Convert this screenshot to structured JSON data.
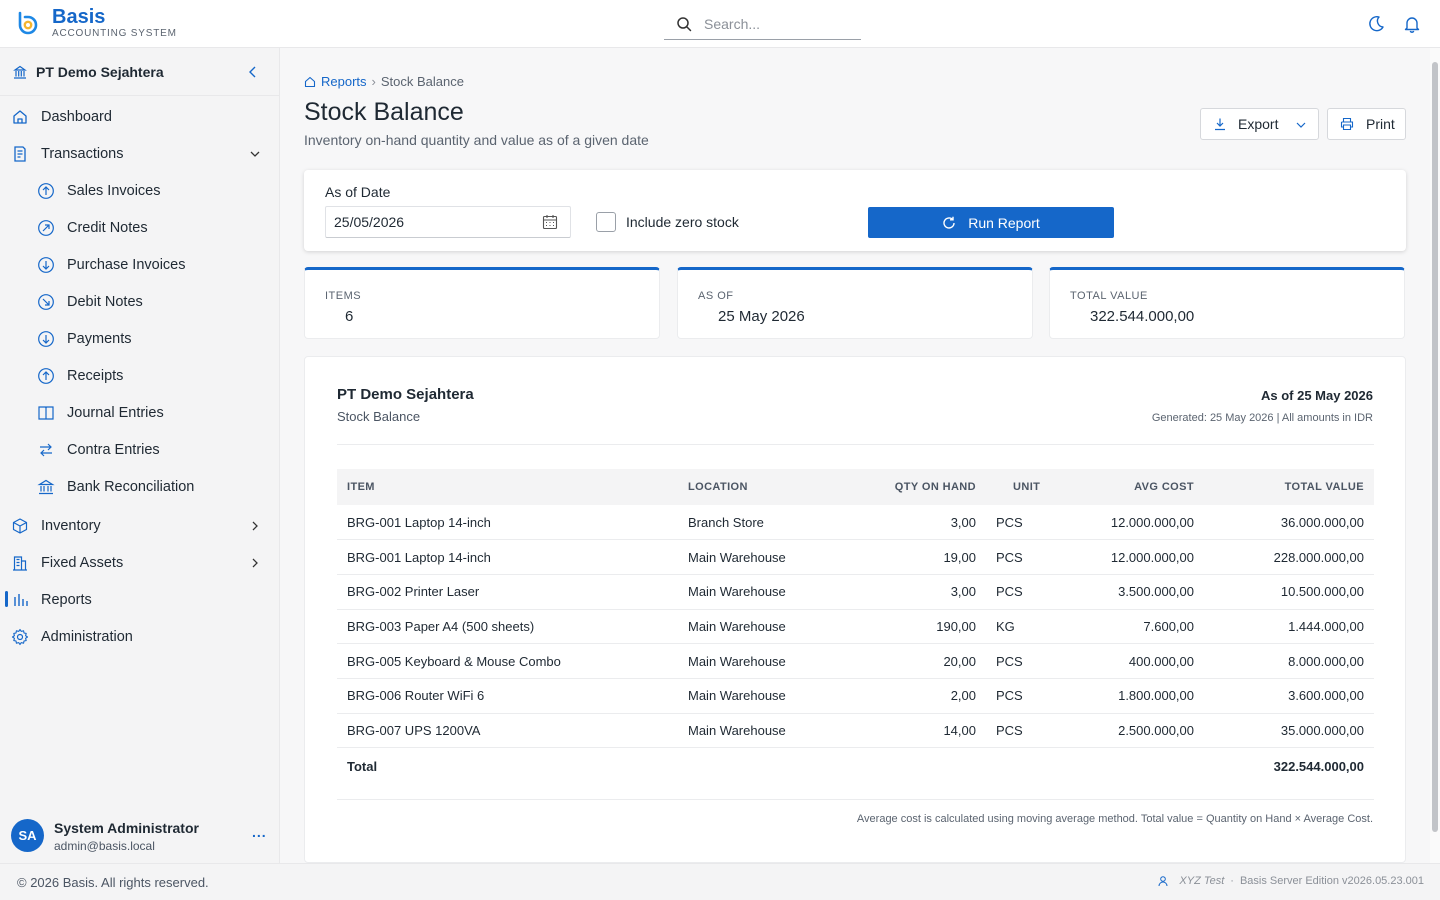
{
  "brand": {
    "name": "Basis",
    "subtitle": "ACCOUNTING SYSTEM"
  },
  "search": {
    "placeholder": "Search..."
  },
  "sidebar": {
    "company": "PT Demo Sejahtera",
    "items": [
      {
        "label": "Dashboard",
        "icon": "home-icon"
      },
      {
        "label": "Transactions",
        "icon": "receipt-icon",
        "expanded": true
      },
      {
        "label": "Sales Invoices",
        "icon": "arrow-up-circle-icon"
      },
      {
        "label": "Credit Notes",
        "icon": "arrow-up-right-circle-icon"
      },
      {
        "label": "Purchase Invoices",
        "icon": "arrow-down-circle-icon"
      },
      {
        "label": "Debit Notes",
        "icon": "arrow-down-right-circle-icon"
      },
      {
        "label": "Payments",
        "icon": "arrow-down-circle-icon"
      },
      {
        "label": "Receipts",
        "icon": "arrow-up-circle-icon"
      },
      {
        "label": "Journal Entries",
        "icon": "book-icon"
      },
      {
        "label": "Contra Entries",
        "icon": "swap-icon"
      },
      {
        "label": "Bank Reconciliation",
        "icon": "bank-icon"
      },
      {
        "label": "Inventory",
        "icon": "box-icon"
      },
      {
        "label": "Fixed Assets",
        "icon": "building-icon"
      },
      {
        "label": "Reports",
        "icon": "bar-chart-icon",
        "active": true
      },
      {
        "label": "Administration",
        "icon": "gear-icon"
      }
    ],
    "user": {
      "initials": "SA",
      "name": "System Administrator",
      "email": "admin@basis.local",
      "more": "..."
    }
  },
  "breadcrumb": {
    "parent": "Reports",
    "separator": "›",
    "current": "Stock Balance"
  },
  "page": {
    "title": "Stock Balance",
    "subtitle": "Inventory on-hand quantity and value as of a given date",
    "export_label": "Export",
    "print_label": "Print"
  },
  "filter": {
    "date_label": "As of Date",
    "date_value": "25/05/2026",
    "zero_stock_label": "Include zero stock",
    "zero_stock_checked": false,
    "run_label": "Run Report"
  },
  "stats": [
    {
      "label": "ITEMS",
      "value": "6"
    },
    {
      "label": "AS OF",
      "value": "25 May 2026"
    },
    {
      "label": "TOTAL VALUE",
      "value": "322.544.000,00"
    }
  ],
  "report": {
    "company": "PT Demo Sejahtera",
    "title": "Stock Balance",
    "as_of": "As of 25 May 2026",
    "generated": "Generated: 25 May 2026 | All amounts in IDR",
    "columns": [
      "ITEM",
      "LOCATION",
      "QTY ON HAND",
      "UNIT",
      "AVG COST",
      "TOTAL VALUE"
    ],
    "rows": [
      {
        "item": "BRG-001  Laptop 14-inch",
        "location": "Branch Store",
        "qty": "3,00",
        "unit": "PCS",
        "avg_cost": "12.000.000,00",
        "total": "36.000.000,00"
      },
      {
        "item": "BRG-001  Laptop 14-inch",
        "location": "Main Warehouse",
        "qty": "19,00",
        "unit": "PCS",
        "avg_cost": "12.000.000,00",
        "total": "228.000.000,00"
      },
      {
        "item": "BRG-002  Printer Laser",
        "location": "Main Warehouse",
        "qty": "3,00",
        "unit": "PCS",
        "avg_cost": "3.500.000,00",
        "total": "10.500.000,00"
      },
      {
        "item": "BRG-003  Paper A4 (500 sheets)",
        "location": "Main Warehouse",
        "qty": "190,00",
        "unit": "KG",
        "avg_cost": "7.600,00",
        "total": "1.444.000,00"
      },
      {
        "item": "BRG-005  Keyboard & Mouse Combo",
        "location": "Main Warehouse",
        "qty": "20,00",
        "unit": "PCS",
        "avg_cost": "400.000,00",
        "total": "8.000.000,00"
      },
      {
        "item": "BRG-006  Router WiFi 6",
        "location": "Main Warehouse",
        "qty": "2,00",
        "unit": "PCS",
        "avg_cost": "1.800.000,00",
        "total": "3.600.000,00"
      },
      {
        "item": "BRG-007  UPS 1200VA",
        "location": "Main Warehouse",
        "qty": "14,00",
        "unit": "PCS",
        "avg_cost": "2.500.000,00",
        "total": "35.000.000,00"
      }
    ],
    "total_label": "Total",
    "total_value": "322.544.000,00",
    "note": "Average cost is calculated using moving average method. Total value = Quantity on Hand × Average Cost."
  },
  "footer": {
    "copyright": "© 2026 Basis. All rights reserved.",
    "tenant": "XYZ Test",
    "separator": "·",
    "edition": "Basis Server Edition v2026.05.23.001"
  },
  "colors": {
    "accent": "#1567c9",
    "sidebar_bg": "#f4f4f5",
    "page_bg": "#f7f7f8"
  }
}
